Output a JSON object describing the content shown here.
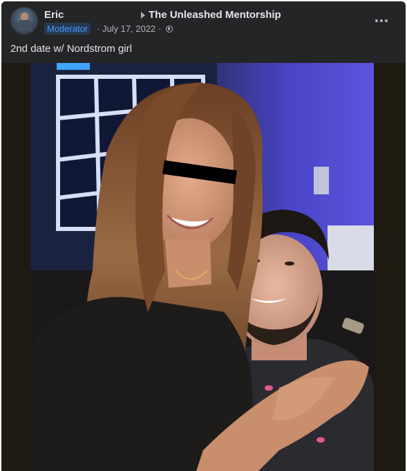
{
  "post": {
    "author": "Eric",
    "group": "The Unleashed Mentorship",
    "badge": "Moderator",
    "meta": "· July 17, 2022 ·",
    "caption": "2nd date w/ Nordstrom girl"
  },
  "icons": {
    "group_arrow": "play-right-icon",
    "privacy": "globe-icon",
    "more": "more-horizontal-icon"
  },
  "colors": {
    "card_bg": "#242526",
    "primary_text": "#e4e6eb",
    "secondary_text": "#b0b3b8",
    "badge_bg": "#263951",
    "badge_text": "#4599ff",
    "photo_wall_blue": "#4b43c7"
  }
}
